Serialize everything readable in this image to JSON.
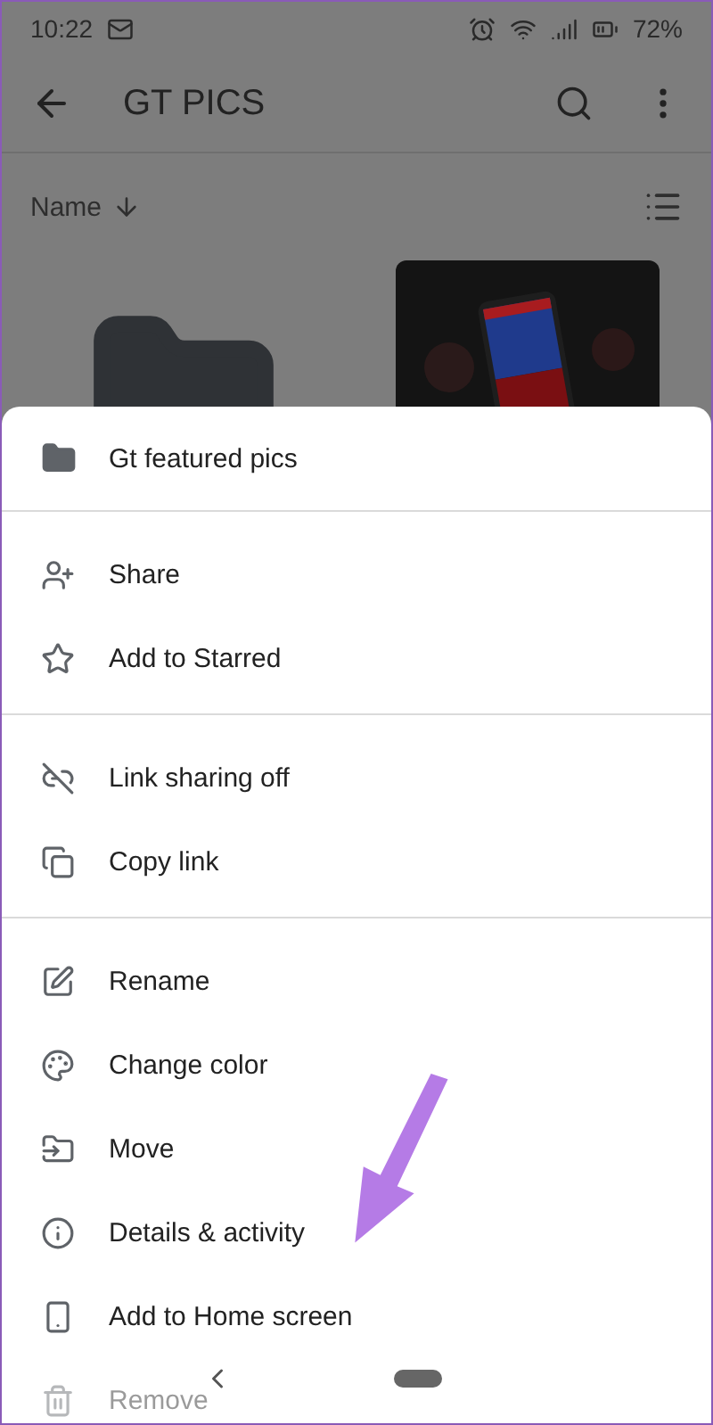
{
  "status_bar": {
    "time": "10:22",
    "battery": "72%"
  },
  "app_bar": {
    "title": "GT PICS"
  },
  "sort": {
    "label": "Name"
  },
  "files": [
    {
      "kind": "folder"
    },
    {
      "kind": "picture"
    }
  ],
  "sheet": {
    "title": "Gt featured pics",
    "groups": [
      [
        {
          "label": "Share"
        },
        {
          "label": "Add to Starred"
        }
      ],
      [
        {
          "label": "Link sharing off"
        },
        {
          "label": "Copy link"
        }
      ],
      [
        {
          "label": "Rename"
        },
        {
          "label": "Change color"
        },
        {
          "label": "Move"
        },
        {
          "label": "Details & activity"
        },
        {
          "label": "Add to Home screen"
        },
        {
          "label": "Remove"
        }
      ]
    ]
  }
}
